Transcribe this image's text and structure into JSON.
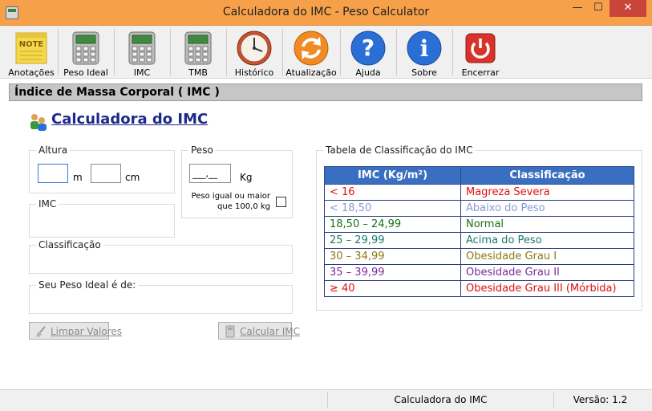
{
  "window": {
    "title": "Calculadora do IMC - Peso Calculator",
    "min": "—",
    "max": "☐",
    "close": "✕"
  },
  "toolbar": {
    "items": [
      {
        "label": "Anotações",
        "icon": "note-icon"
      },
      {
        "label": "Peso Ideal",
        "icon": "calculator-icon"
      },
      {
        "label": "IMC",
        "icon": "calculator-icon"
      },
      {
        "label": "TMB",
        "icon": "calculator-icon"
      },
      {
        "label": "Histórico",
        "icon": "clock-icon"
      },
      {
        "label": "Atualização",
        "icon": "refresh-icon"
      },
      {
        "label": "Ajuda",
        "icon": "help-icon"
      },
      {
        "label": "Sobre",
        "icon": "info-icon"
      },
      {
        "label": "Encerrar",
        "icon": "power-icon"
      }
    ]
  },
  "section_header": "Índice de Massa Corporal ( IMC )",
  "calc_title": "Calculadora do IMC",
  "form": {
    "altura_legend": "Altura",
    "unit_m": "m",
    "unit_cm": "cm",
    "peso_legend": "Peso",
    "peso_value": "___,__",
    "unit_kg": "Kg",
    "peso_check_line1": "Peso igual ou maior",
    "peso_check_line2": "que 100,0 kg",
    "imc_legend": "IMC",
    "classificacao_legend": "Classificação",
    "peso_ideal_legend": "Seu Peso Ideal é de:",
    "limpar_label": "Limpar Valores",
    "calcular_label": "Calcular IMC"
  },
  "tabela": {
    "legend": "Tabela de Classificação do IMC",
    "headers": [
      "IMC (Kg/m²)",
      "Classificação"
    ],
    "rows": [
      {
        "imc": "< 16",
        "classe": "Magreza Severa",
        "color": "#e01010"
      },
      {
        "imc": "< 18,50",
        "classe": "Abaixo do Peso",
        "color": "#8a9ad8"
      },
      {
        "imc": "18,50 – 24,99",
        "classe": "Normal",
        "color": "#1a6e1a"
      },
      {
        "imc": "25 – 29,99",
        "classe": "Acima do Peso",
        "color": "#1a7a6a"
      },
      {
        "imc": "30 – 34,99",
        "classe": "Obesidade Grau I",
        "color": "#8a7a10"
      },
      {
        "imc": "35 – 39,99",
        "classe": "Obesidade Grau II",
        "color": "#7a2a9a"
      },
      {
        "imc": "≥ 40",
        "classe": "Obesidade Grau III (Mórbida)",
        "color": "#e01010"
      }
    ]
  },
  "status": {
    "center": "Calculadora do IMC",
    "version": "Versão: 1.2"
  }
}
